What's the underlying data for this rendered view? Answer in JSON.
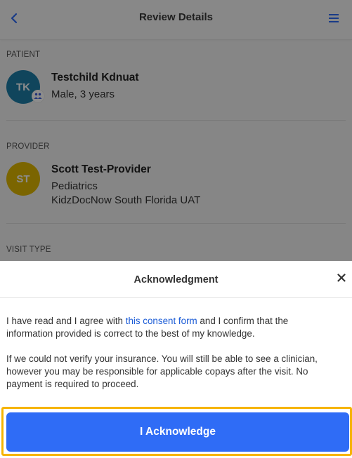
{
  "header": {
    "title": "Review Details",
    "back_icon": "chevron-left-icon",
    "menu_icon": "hamburger-menu-icon"
  },
  "patient": {
    "section_label": "PATIENT",
    "initials": "TK",
    "name": "Testchild Kdnuat",
    "details": "Male, 3 years",
    "badge_icon": "family-icon",
    "avatar_color": "#1e7fa8"
  },
  "provider": {
    "section_label": "PROVIDER",
    "initials": "ST",
    "name": "Scott Test-Provider",
    "specialty": "Pediatrics",
    "organization": "KidzDocNow South Florida UAT",
    "avatar_color": "#e0b800"
  },
  "visit": {
    "section_label": "VISIT TYPE"
  },
  "modal": {
    "title": "Acknowledgment",
    "close_icon": "close-icon",
    "consent_text_before": "I have read and I agree with ",
    "consent_link": "this consent form",
    "consent_text_after": " and I confirm that the information provided is correct to the best of my knowledge.",
    "insurance_text": "If we could not verify your insurance. You will still be able to see a clinician, however you may be responsible for applicable copays after the visit. No payment is required to proceed.",
    "acknowledge_button": "I Acknowledge"
  },
  "colors": {
    "accent": "#2f6cf6",
    "link": "#1a5bd6",
    "focus": "#f6b400"
  }
}
